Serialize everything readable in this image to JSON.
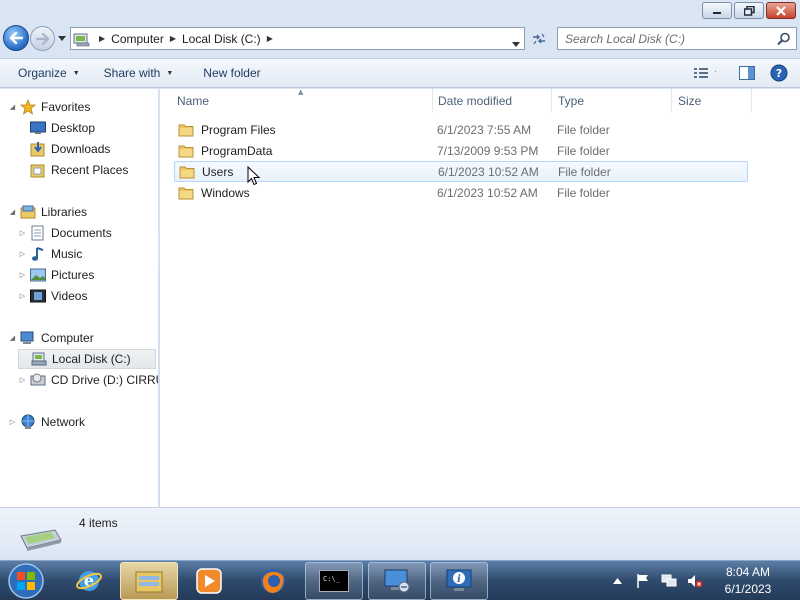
{
  "window": {
    "minimize_icon": "minimize-icon",
    "maximize_icon": "restore-icon",
    "close_icon": "close-icon"
  },
  "address_bar": {
    "breadcrumbs": [
      "Computer",
      "Local Disk (C:)"
    ],
    "location_icon": "computer-drive-icon"
  },
  "search": {
    "placeholder": "Search Local Disk (C:)"
  },
  "toolbar": {
    "organize": "Organize",
    "share_with": "Share with",
    "new_folder": "New folder"
  },
  "nav_pane": {
    "favorites": {
      "label": "Favorites",
      "items": [
        "Desktop",
        "Downloads",
        "Recent Places"
      ]
    },
    "libraries": {
      "label": "Libraries",
      "items": [
        "Documents",
        "Music",
        "Pictures",
        "Videos"
      ]
    },
    "computer": {
      "label": "Computer",
      "items": [
        "Local Disk (C:)",
        "CD Drive (D:) CIRRUS"
      ],
      "selected": "Local Disk (C:)"
    },
    "network": {
      "label": "Network"
    }
  },
  "file_list": {
    "columns": [
      "Name",
      "Date modified",
      "Type",
      "Size"
    ],
    "rows": [
      {
        "name": "Program Files",
        "date": "6/1/2023 7:55 AM",
        "type": "File folder",
        "size": ""
      },
      {
        "name": "ProgramData",
        "date": "7/13/2009 9:53 PM",
        "type": "File folder",
        "size": ""
      },
      {
        "name": "Users",
        "date": "6/1/2023 10:52 AM",
        "type": "File folder",
        "size": ""
      },
      {
        "name": "Windows",
        "date": "6/1/2023 10:52 AM",
        "type": "File folder",
        "size": ""
      }
    ],
    "hovered_row": "Users"
  },
  "details": {
    "item_count": "4 items"
  },
  "taskbar": {
    "items": [
      "internet-explorer",
      "windows-explorer",
      "media-player",
      "firefox",
      "command-prompt",
      "remote-desktop",
      "system-information"
    ],
    "clock_time": "8:04 AM",
    "clock_date": "6/1/2023"
  },
  "colors": {
    "accent": "#2a6fc9",
    "hover_row_border": "#b8d6fb",
    "taskbar": "#2f4a6c"
  }
}
